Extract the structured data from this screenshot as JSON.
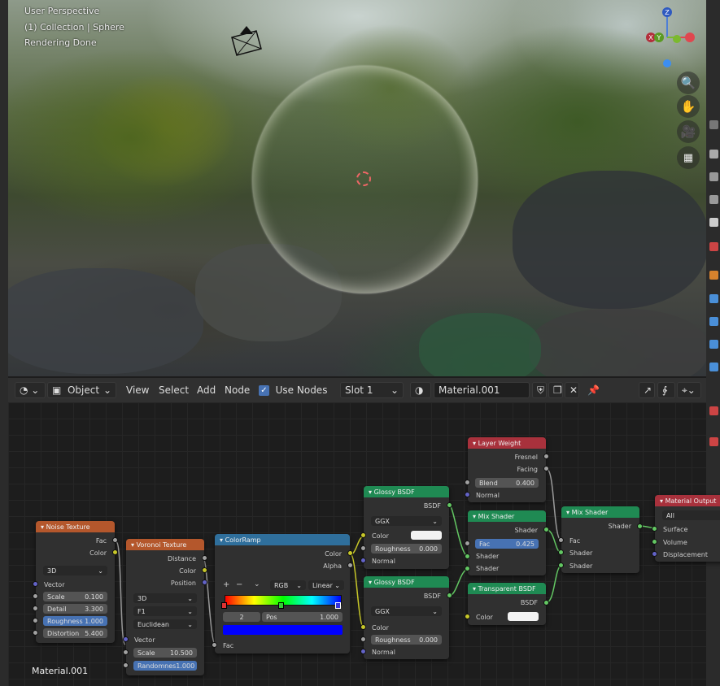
{
  "viewport": {
    "line1": "User Perspective",
    "line2": "(1) Collection | Sphere",
    "line3": "Rendering Done"
  },
  "gizmo": {
    "x": "X",
    "y": "Y",
    "z": "Z"
  },
  "header": {
    "editor_icon": "node-editor-icon",
    "mode": "Object",
    "menus": [
      "View",
      "Select",
      "Add",
      "Node"
    ],
    "use_nodes_label": "Use Nodes",
    "use_nodes": true,
    "slot": "Slot 1",
    "material": "Material.001"
  },
  "canvas_label": "Material.001",
  "nodes": {
    "noise": {
      "title": "Noise Texture",
      "out_fac": "Fac",
      "out_color": "Color",
      "dim": "3D",
      "in_vector": "Vector",
      "scale_label": "Scale",
      "scale": "0.100",
      "detail_label": "Detail",
      "detail": "3.300",
      "rough_label": "Roughness",
      "rough": "1.000",
      "dist_label": "Distortion",
      "dist": "5.400"
    },
    "voronoi": {
      "title": "Voronoi Texture",
      "out_distance": "Distance",
      "out_color": "Color",
      "out_position": "Position",
      "dim": "3D",
      "feature": "F1",
      "metric": "Euclidean",
      "in_vector": "Vector",
      "scale_label": "Scale",
      "scale": "10.500",
      "rand_label": "Randomnes",
      "rand": "1.000"
    },
    "colorramp": {
      "title": "ColorRamp",
      "out_color": "Color",
      "out_alpha": "Alpha",
      "mode": "RGB",
      "interp": "Linear",
      "index": "2",
      "pos_label": "Pos",
      "pos": "1.000",
      "in_fac": "Fac"
    },
    "glossy1": {
      "title": "Glossy BSDF",
      "out": "BSDF",
      "dist": "GGX",
      "in_color": "Color",
      "rough_label": "Roughness",
      "rough": "0.000",
      "in_normal": "Normal"
    },
    "glossy2": {
      "title": "Glossy BSDF",
      "out": "BSDF",
      "dist": "GGX",
      "in_color": "Color",
      "rough_label": "Roughness",
      "rough": "0.000",
      "in_normal": "Normal"
    },
    "layerweight": {
      "title": "Layer Weight",
      "out_fresnel": "Fresnel",
      "out_facing": "Facing",
      "blend_label": "Blend",
      "blend": "0.400",
      "in_normal": "Normal"
    },
    "mix1": {
      "title": "Mix Shader",
      "out": "Shader",
      "fac_label": "Fac",
      "fac": "0.425",
      "in_shader1": "Shader",
      "in_shader2": "Shader"
    },
    "transparent": {
      "title": "Transparent BSDF",
      "out": "BSDF",
      "in_color": "Color"
    },
    "mix2": {
      "title": "Mix Shader",
      "out": "Shader",
      "in_fac": "Fac",
      "in_shader1": "Shader",
      "in_shader2": "Shader"
    },
    "output": {
      "title": "Material Output",
      "target": "All",
      "in_surface": "Surface",
      "in_volume": "Volume",
      "in_displacement": "Displacement"
    }
  },
  "colors": {
    "texture_header": "#b4572c",
    "shader_header": "#1f8a53",
    "converter_header": "#2f6f9c",
    "input_header": "#a8313c",
    "output_header": "#a8313c",
    "socket_gray": "#a1a1a1",
    "socket_yellow": "#c7c729",
    "socket_green": "#63c763",
    "socket_purple": "#6363c7",
    "accent": "#4772b3"
  }
}
